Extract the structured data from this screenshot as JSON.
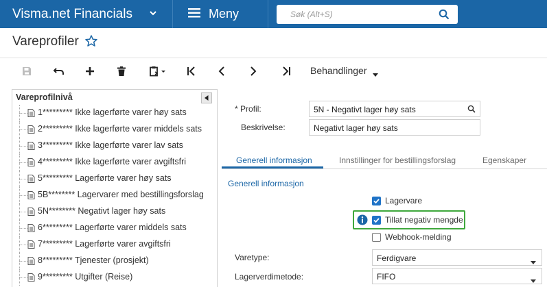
{
  "header": {
    "app_title": "Visma.net Financials",
    "menu_label": "Meny",
    "search_placeholder": "Søk (Alt+S)"
  },
  "page": {
    "title": "Vareprofiler"
  },
  "toolbar": {
    "actions_label": "Behandlinger"
  },
  "tree": {
    "title": "Vareprofilnivå",
    "items": [
      {
        "label": "1********* Ikke lagerførte varer høy sats"
      },
      {
        "label": "2********* Ikke lagerførte varer middels sats"
      },
      {
        "label": "3********* Ikke lagerførte varer lav sats"
      },
      {
        "label": "4********* Ikke lagerførte varer avgiftsfri"
      },
      {
        "label": "5********* Lagerførte varer høy sats"
      },
      {
        "label": "5B******** Lagervarer med bestillingsforslag"
      },
      {
        "label": "5N******** Negativt lager høy sats"
      },
      {
        "label": "6********* Lagerførte varer middels sats"
      },
      {
        "label": "7********* Lagerførte varer avgiftsfri"
      },
      {
        "label": "8********* Tjenester (prosjekt)"
      },
      {
        "label": "9********* Utgifter (Reise)"
      }
    ]
  },
  "form": {
    "profile_label": "Profil:",
    "profile_star": "*",
    "profile_value": "5N - Negativt lager høy sats",
    "description_label": "Beskrivelse:",
    "description_value": "Negativt lager høy sats"
  },
  "tabs": [
    {
      "label": "Generell informasjon"
    },
    {
      "label": "Innstillinger for bestillingsforslag"
    },
    {
      "label": "Egenskaper"
    }
  ],
  "general": {
    "section_title": "Generell informasjon",
    "checkboxes": [
      {
        "label": "Lagervare",
        "checked": true
      },
      {
        "label": "Tillat negativ mengde",
        "checked": true
      },
      {
        "label": "Webhook-melding",
        "checked": false
      }
    ],
    "item_type_label": "Varetype:",
    "item_type_value": "Ferdigvare",
    "valuation_label": "Lagerverdimetode:",
    "valuation_value": "FIFO"
  },
  "colors": {
    "brand": "#1b66a6",
    "highlight": "#3fa83c",
    "checkbox": "#1f73c7"
  }
}
